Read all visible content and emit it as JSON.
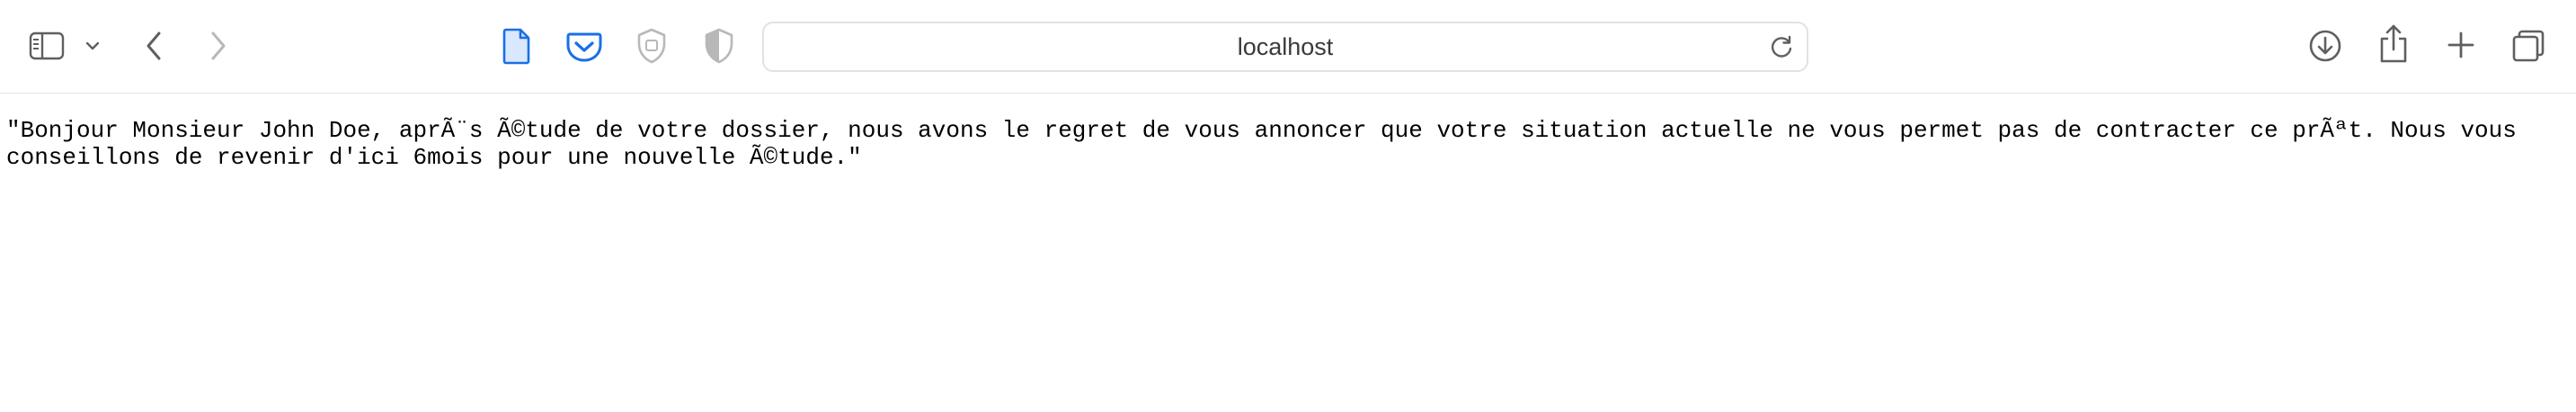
{
  "toolbar": {
    "address": "localhost",
    "icons": {
      "sidebar": "sidebar-icon",
      "sidebar_menu": "chevron-down-icon",
      "back": "chevron-left-icon",
      "forward": "chevron-right-icon",
      "page": "page-icon",
      "pocket": "pocket-icon",
      "privacy": "shield-icon",
      "privacy_half": "half-shield-icon",
      "reload": "reload-icon",
      "downloads": "download-icon",
      "share": "share-icon",
      "new_tab": "plus-icon",
      "tabs": "tabs-overview-icon"
    }
  },
  "page": {
    "text": "\"Bonjour Monsieur John Doe, aprÃ¨s Ã©tude de votre dossier, nous avons le regret de vous annoncer que votre situation actuelle ne vous permet pas de contracter ce prÃªt. Nous vous conseillons de revenir d'ici 6mois pour une nouvelle Ã©tude.\""
  },
  "colors": {
    "accent": "#1a6fe8",
    "icon_gray": "#5f5f5f",
    "icon_light": "#b8b8b8"
  }
}
